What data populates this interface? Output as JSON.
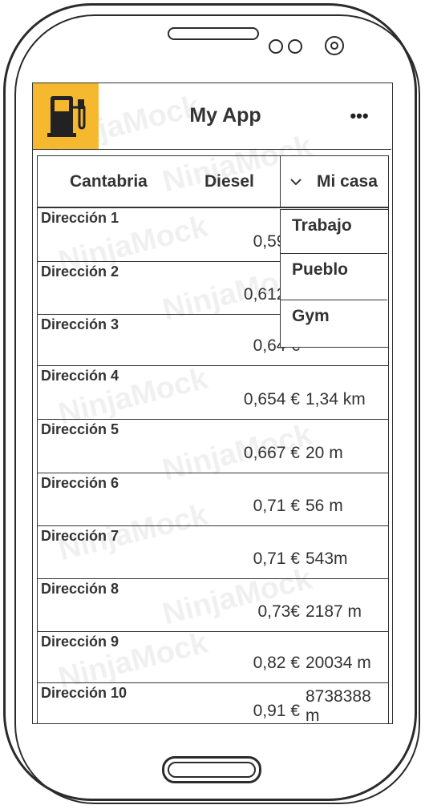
{
  "app": {
    "title": "My App",
    "more_icon": "more-horizontal-icon",
    "icon": "fuel-pump-icon",
    "accent": "#f5b82e"
  },
  "table": {
    "headers": {
      "region": "Cantabria",
      "fuel": "Diesel",
      "location": "Mi casa"
    },
    "rows": [
      {
        "name": "Dirección 1",
        "price": "0,59 €",
        "distance": ""
      },
      {
        "name": "Dirección 2",
        "price": "0,612 €",
        "distance": ""
      },
      {
        "name": "Dirección 3",
        "price": "0,64 €",
        "distance": ""
      },
      {
        "name": "Dirección 4",
        "price": "0,654 €",
        "distance": "1,34 km"
      },
      {
        "name": "Dirección 5",
        "price": "0,667 €",
        "distance": "20 m"
      },
      {
        "name": "Dirección 6",
        "price": "0,71 €",
        "distance": "56 m"
      },
      {
        "name": "Dirección 7",
        "price": "0,71 €",
        "distance": "543m"
      },
      {
        "name": "Dirección 8",
        "price": "0,73€",
        "distance": "2187 m"
      },
      {
        "name": "Dirección 9",
        "price": "0,82 €",
        "distance": "20034 m"
      },
      {
        "name": "Dirección 10",
        "price": "0,91 €",
        "distance": "8738388 m"
      }
    ]
  },
  "location_menu": {
    "selected": "Mi casa",
    "options": [
      "Trabajo",
      "Pueblo",
      "Gym"
    ]
  },
  "watermark": "NinjaMock"
}
